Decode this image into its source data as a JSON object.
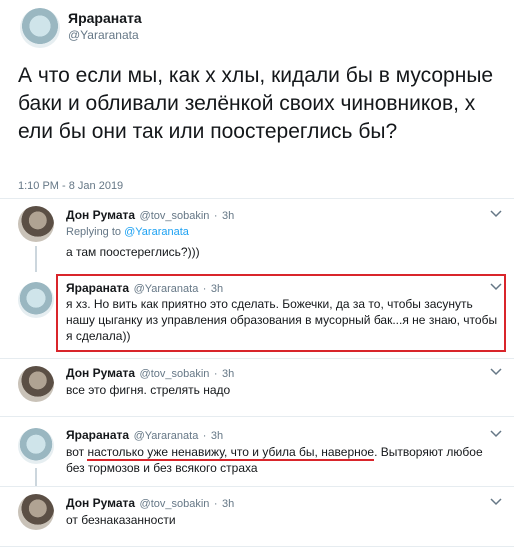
{
  "main_tweet": {
    "author_name": "Ярараната",
    "author_handle": "@Yararanata",
    "text": "А что если мы, как х  хлы, кидали бы в мусорные баки и обливали зелёнкой своих чиновников, х  ели бы они так или поостереглись бы?",
    "timestamp": "1:10 PM - 8 Jan 2019"
  },
  "replies": [
    {
      "author_name": "Дон Румата",
      "author_handle": "@tov_sobakin",
      "time": "3h",
      "replying_to_label": "Replying to",
      "replying_to_handle": "@Yararanata",
      "text": "а там поостереглись?)))"
    },
    {
      "author_name": "Ярараната",
      "author_handle": "@Yararanata",
      "time": "3h",
      "text": "я хз. Но вить как приятно это сделать. Божечки, да за то, чтобы засунуть нашу цыганку из управления образования в мусорный бак...я не знаю, чтобы я сделала))"
    },
    {
      "author_name": "Дон Румата",
      "author_handle": "@tov_sobakin",
      "time": "3h",
      "text": "все это фигня. стрелять надо"
    },
    {
      "author_name": "Ярараната",
      "author_handle": "@Yararanata",
      "time": "3h",
      "text_prefix": "вот ",
      "text_underlined": "настолько уже ненавижу, что и убила бы, наверное",
      "text_suffix": ". Вытворяют любое без тормозов и без всякого страха"
    },
    {
      "author_name": "Дон Румата",
      "author_handle": "@tov_sobakin",
      "time": "3h",
      "text": "от безнаказанности"
    }
  ],
  "separator": "·",
  "colors": {
    "text": "#14171a",
    "secondary": "#657786",
    "link": "#1da1f2",
    "highlight": "#d9252b",
    "divider": "#e6ecf0"
  },
  "icons": {
    "more": "chevron-down-icon"
  }
}
